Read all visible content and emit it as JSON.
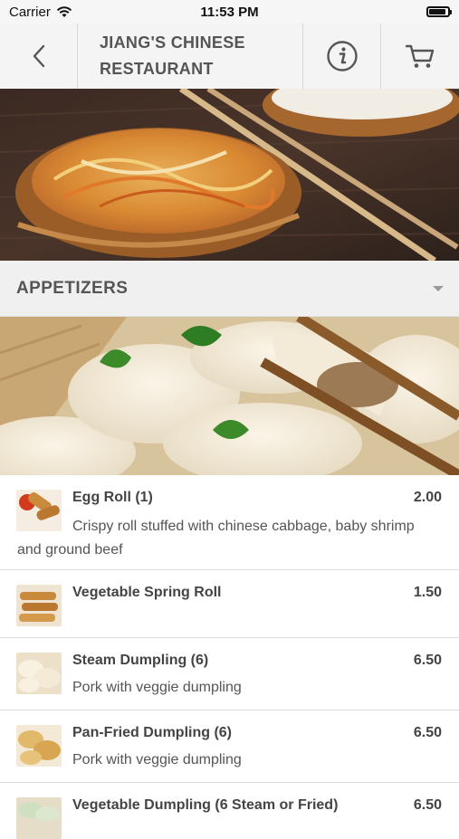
{
  "status_bar": {
    "carrier": "Carrier",
    "time": "11:53 PM",
    "battery_level": 0.9
  },
  "header": {
    "title_line1": "JIANG'S CHINESE",
    "title_line2": "RESTAURANT"
  },
  "section": {
    "label": "APPETIZERS"
  },
  "items": [
    {
      "name": "Egg Roll (1)",
      "price": "2.00",
      "desc": "Crispy roll stuffed with chinese cabbage, baby shrimp and ground beef"
    },
    {
      "name": "Vegetable Spring Roll",
      "price": "1.50",
      "desc": ""
    },
    {
      "name": "Steam Dumpling (6)",
      "price": "6.50",
      "desc": "Pork with veggie dumpling"
    },
    {
      "name": "Pan-Fried Dumpling (6)",
      "price": "6.50",
      "desc": "Pork with veggie dumpling"
    },
    {
      "name": "Vegetable Dumpling (6 Steam or Fried)",
      "price": "6.50",
      "desc": ""
    }
  ],
  "icons": {
    "back": "chevron-left-icon",
    "info": "info-icon",
    "cart": "cart-icon",
    "section_toggle": "caret-down-icon"
  }
}
